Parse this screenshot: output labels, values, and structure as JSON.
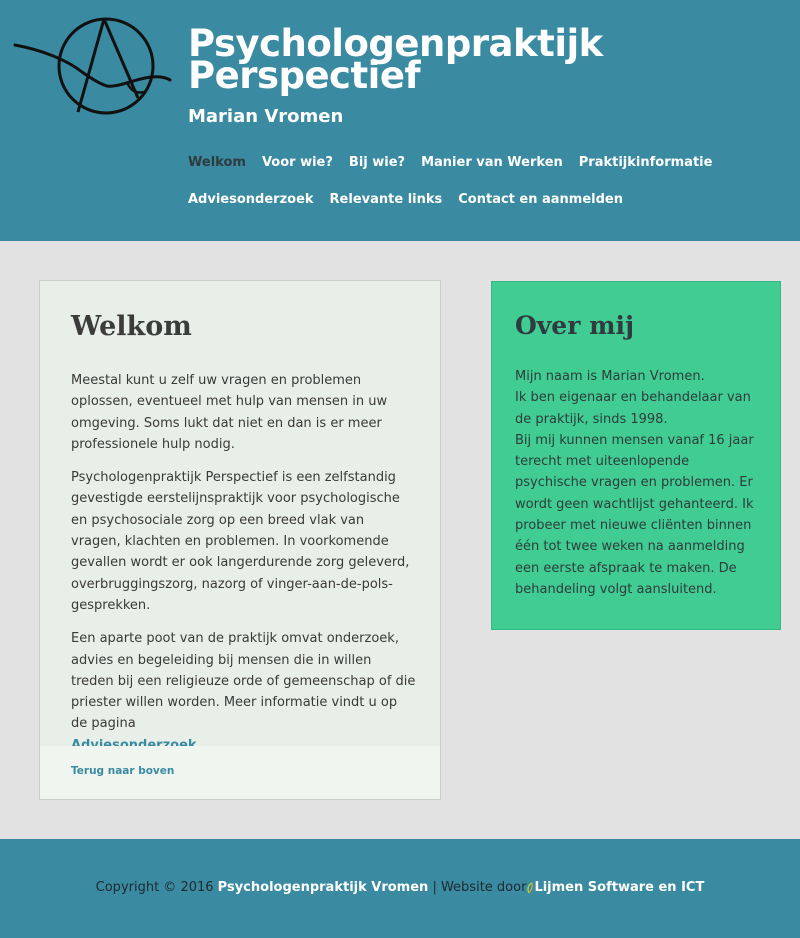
{
  "header": {
    "title": "Psychologenpraktijk Perspectief",
    "subtitle": "Marian Vromen",
    "logo_icon": "seagull-circle-logo"
  },
  "nav": {
    "row1": [
      "Welkom",
      "Voor wie?",
      "Bij wie?",
      "Manier van Werken",
      "Praktijkinformatie"
    ],
    "row2": [
      "Adviesonderzoek",
      "Relevante links",
      "Contact en aanmelden"
    ],
    "active": "Welkom"
  },
  "main": {
    "title": "Welkom",
    "p1": "Meestal kunt u zelf uw vragen en problemen oplossen, eventueel met hulp van mensen in uw omgeving. Soms lukt dat niet en dan is er meer professionele hulp nodig.",
    "p2": "Psychologenpraktijk Perspectief is een zelfstandig gevestigde eerstelijnspraktijk voor psychologische en psychosociale zorg op een breed vlak van vragen, klachten en problemen. In voorkomende gevallen wordt er ook langerdurende zorg geleverd, overbruggingszorg, nazorg of vinger-aan-de-pols-gesprekken.",
    "p3": "Een aparte poot van de praktijk omvat onderzoek, advies en begeleiding bij mensen die in willen treden bij een religieuze orde of gemeenschap of die priester willen worden. Meer informatie vindt u op de pagina",
    "p3_link": "Adviesonderzoek",
    "p3_end": ".",
    "back_to_top": "Terug naar boven"
  },
  "side": {
    "title": "Over mij",
    "lines": [
      "Mijn naam is Marian Vromen.",
      "Ik ben eigenaar en behandelaar van de praktijk, sinds 1998.",
      "Bij mij kunnen mensen vanaf 16 jaar terecht met uiteenlopende psychische vragen en problemen. Er wordt geen wachtlijst gehanteerd. Ik probeer met nieuwe cliënten binnen één tot twee weken na aanmelding een eerste afspraak te maken. De behandeling volgt aansluitend."
    ]
  },
  "footer": {
    "copyright": "Copyright © 2016",
    "practice_link": "Psychologenpraktijk Vromen",
    "separator": "|",
    "website_by": "Website door",
    "company_link": "Lijmen Software en ICT"
  },
  "colors": {
    "header_bg": "#3a8aa2",
    "page_bg": "#e2e2e2",
    "side_bg": "#40cc93",
    "link": "#3a8aa2"
  }
}
